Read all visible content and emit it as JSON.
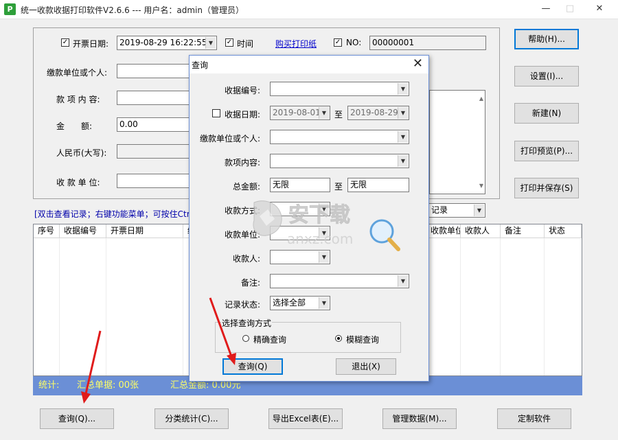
{
  "window": {
    "title": "统一收款收据打印软件V2.6.6 --- 用户名：admin（管理员）",
    "app_icon": "P",
    "controls": {
      "minimize": "—",
      "maximize": "□",
      "close": "✕"
    }
  },
  "form": {
    "invoice_date_label": "开票日期:",
    "invoice_date_checked": true,
    "invoice_date_value": "2019-08-29 16:22:55",
    "time_label": "时间",
    "time_checked": true,
    "buy_paper_link": "购买打印纸",
    "no_label": "NO:",
    "no_checked": true,
    "no_value": "00000001",
    "payer_label": "缴款单位或个人:",
    "item_label": "款 项 内 容:",
    "amount_label": "金　　额:",
    "amount_value": "0.00",
    "rmb_label": "人民币(大写):",
    "receiver_unit_label": "收 款 单 位:"
  },
  "right_buttons": {
    "help": "帮助(H)...",
    "settings": "设置(I)...",
    "new": "新建(N)",
    "print_preview": "打印预览(P)...",
    "print_save": "打印并保存(S)"
  },
  "hint": "[双击查看记录；右键功能菜单；可按住Ctr",
  "records_combo": "记录",
  "table": {
    "columns_left": [
      "序号",
      "收据编号",
      "开票日期",
      "缴"
    ],
    "columns_right": [
      "收款单位",
      "收款人",
      "备注",
      "状态"
    ]
  },
  "statusbar": {
    "stats": "统计:",
    "summary_count": "汇总单据: 00张",
    "summary_amount": "汇总金额: 0.00元"
  },
  "bottom_buttons": {
    "query": "查询(Q)...",
    "category": "分类统计(C)...",
    "export": "导出Excel表(E)...",
    "manage": "管理数据(M)...",
    "custom": "定制软件"
  },
  "dialog": {
    "title": "查询",
    "close": "✕",
    "receipt_no_label": "收据编号:",
    "date_label": "收据日期:",
    "date_checked": false,
    "date_from": "2019-08-01",
    "date_to_sep": "至",
    "date_to": "2019-08-29",
    "payer_label": "缴款单位或个人:",
    "item_label": "款项内容:",
    "amount_label": "总金额:",
    "amount_from": "无限",
    "amount_to_sep": "至",
    "amount_to": "无限",
    "method_label": "收款方式:",
    "unit_label": "收款单位:",
    "receiver_label": "收款人:",
    "note_label": "备注:",
    "status_label": "记录状态:",
    "status_value": "选择全部",
    "query_mode_title": "选择查询方式",
    "exact_label": "精确查询",
    "fuzzy_label": "模糊查询",
    "fuzzy_selected": true,
    "query_button": "查询(Q)",
    "exit_button": "退出(X)"
  },
  "watermark": {
    "brand": "安下载",
    "domain": "anxz.com"
  },
  "colors": {
    "accent": "#0078d7",
    "status_bar": "#6b8fd6",
    "status_text": "#ffff66",
    "arrow": "#e01b1b",
    "link": "#0000cc"
  }
}
